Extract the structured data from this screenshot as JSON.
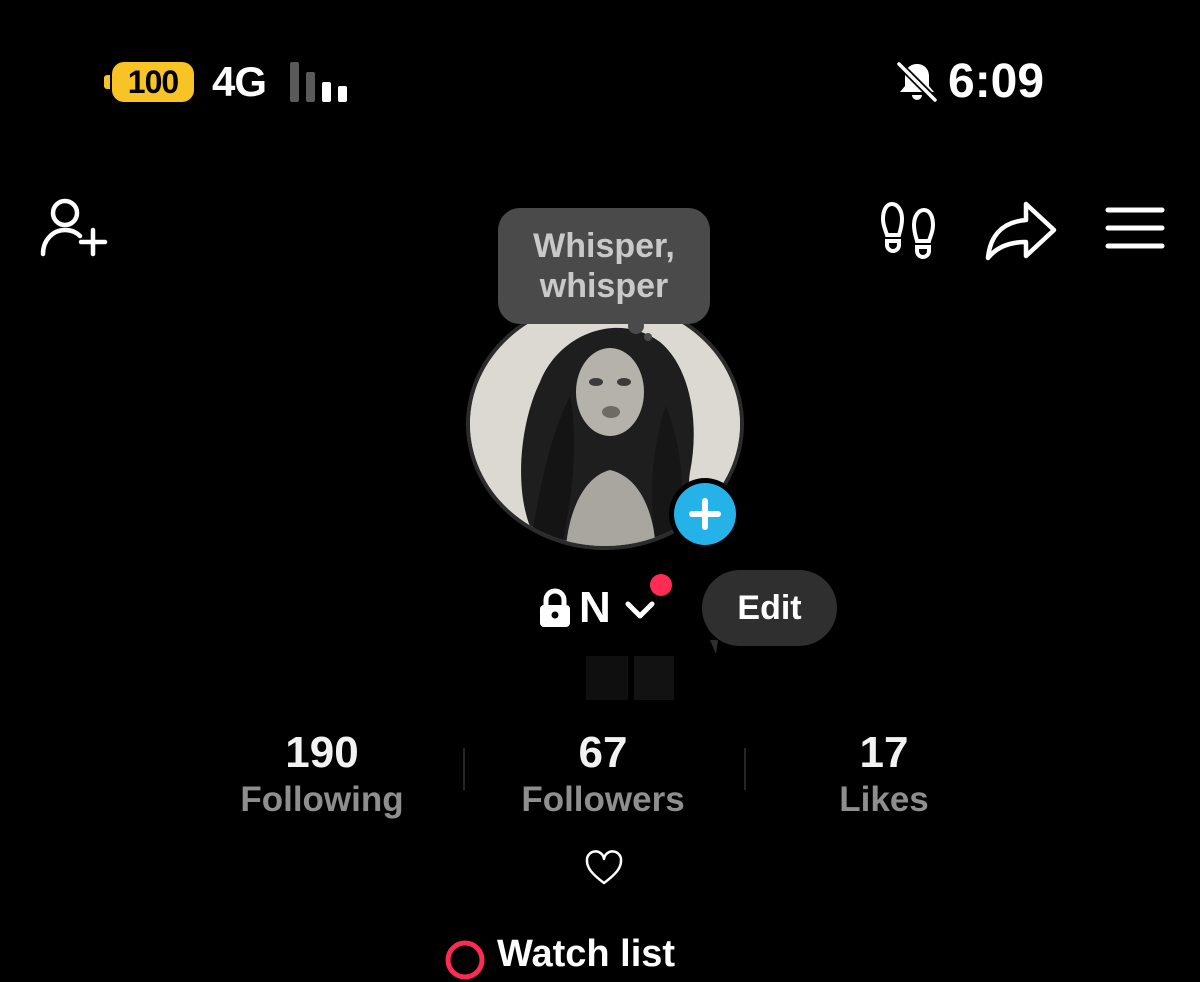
{
  "status_bar": {
    "battery_level": "100",
    "battery_color": "#f7c325",
    "network": "4G",
    "signal_bars_active": 1,
    "signal_bars_total": 4,
    "time": "6:09",
    "mute_icon": "bell-slash-icon"
  },
  "header": {
    "left_icon": "add-friend-icon",
    "right_icons": [
      "footprint-icon",
      "share-icon",
      "menu-icon"
    ]
  },
  "profile": {
    "note_bubble": "Whisper, whisper",
    "username": "N",
    "private_icon": "lock-icon",
    "has_notification_dot": true,
    "notification_dot_color": "#fe2c55",
    "add_story_color": "#25b2e8",
    "edit_label": "Edit"
  },
  "stats": [
    {
      "value": "190",
      "label": "Following"
    },
    {
      "value": "67",
      "label": "Followers"
    },
    {
      "value": "17",
      "label": "Likes"
    }
  ],
  "bio": {
    "icon": "heart-outline-icon",
    "text": "♡"
  },
  "bottom_row": {
    "label": "Watch list",
    "icon": "watch-list-icon",
    "icon_color": "#fe2c55"
  }
}
